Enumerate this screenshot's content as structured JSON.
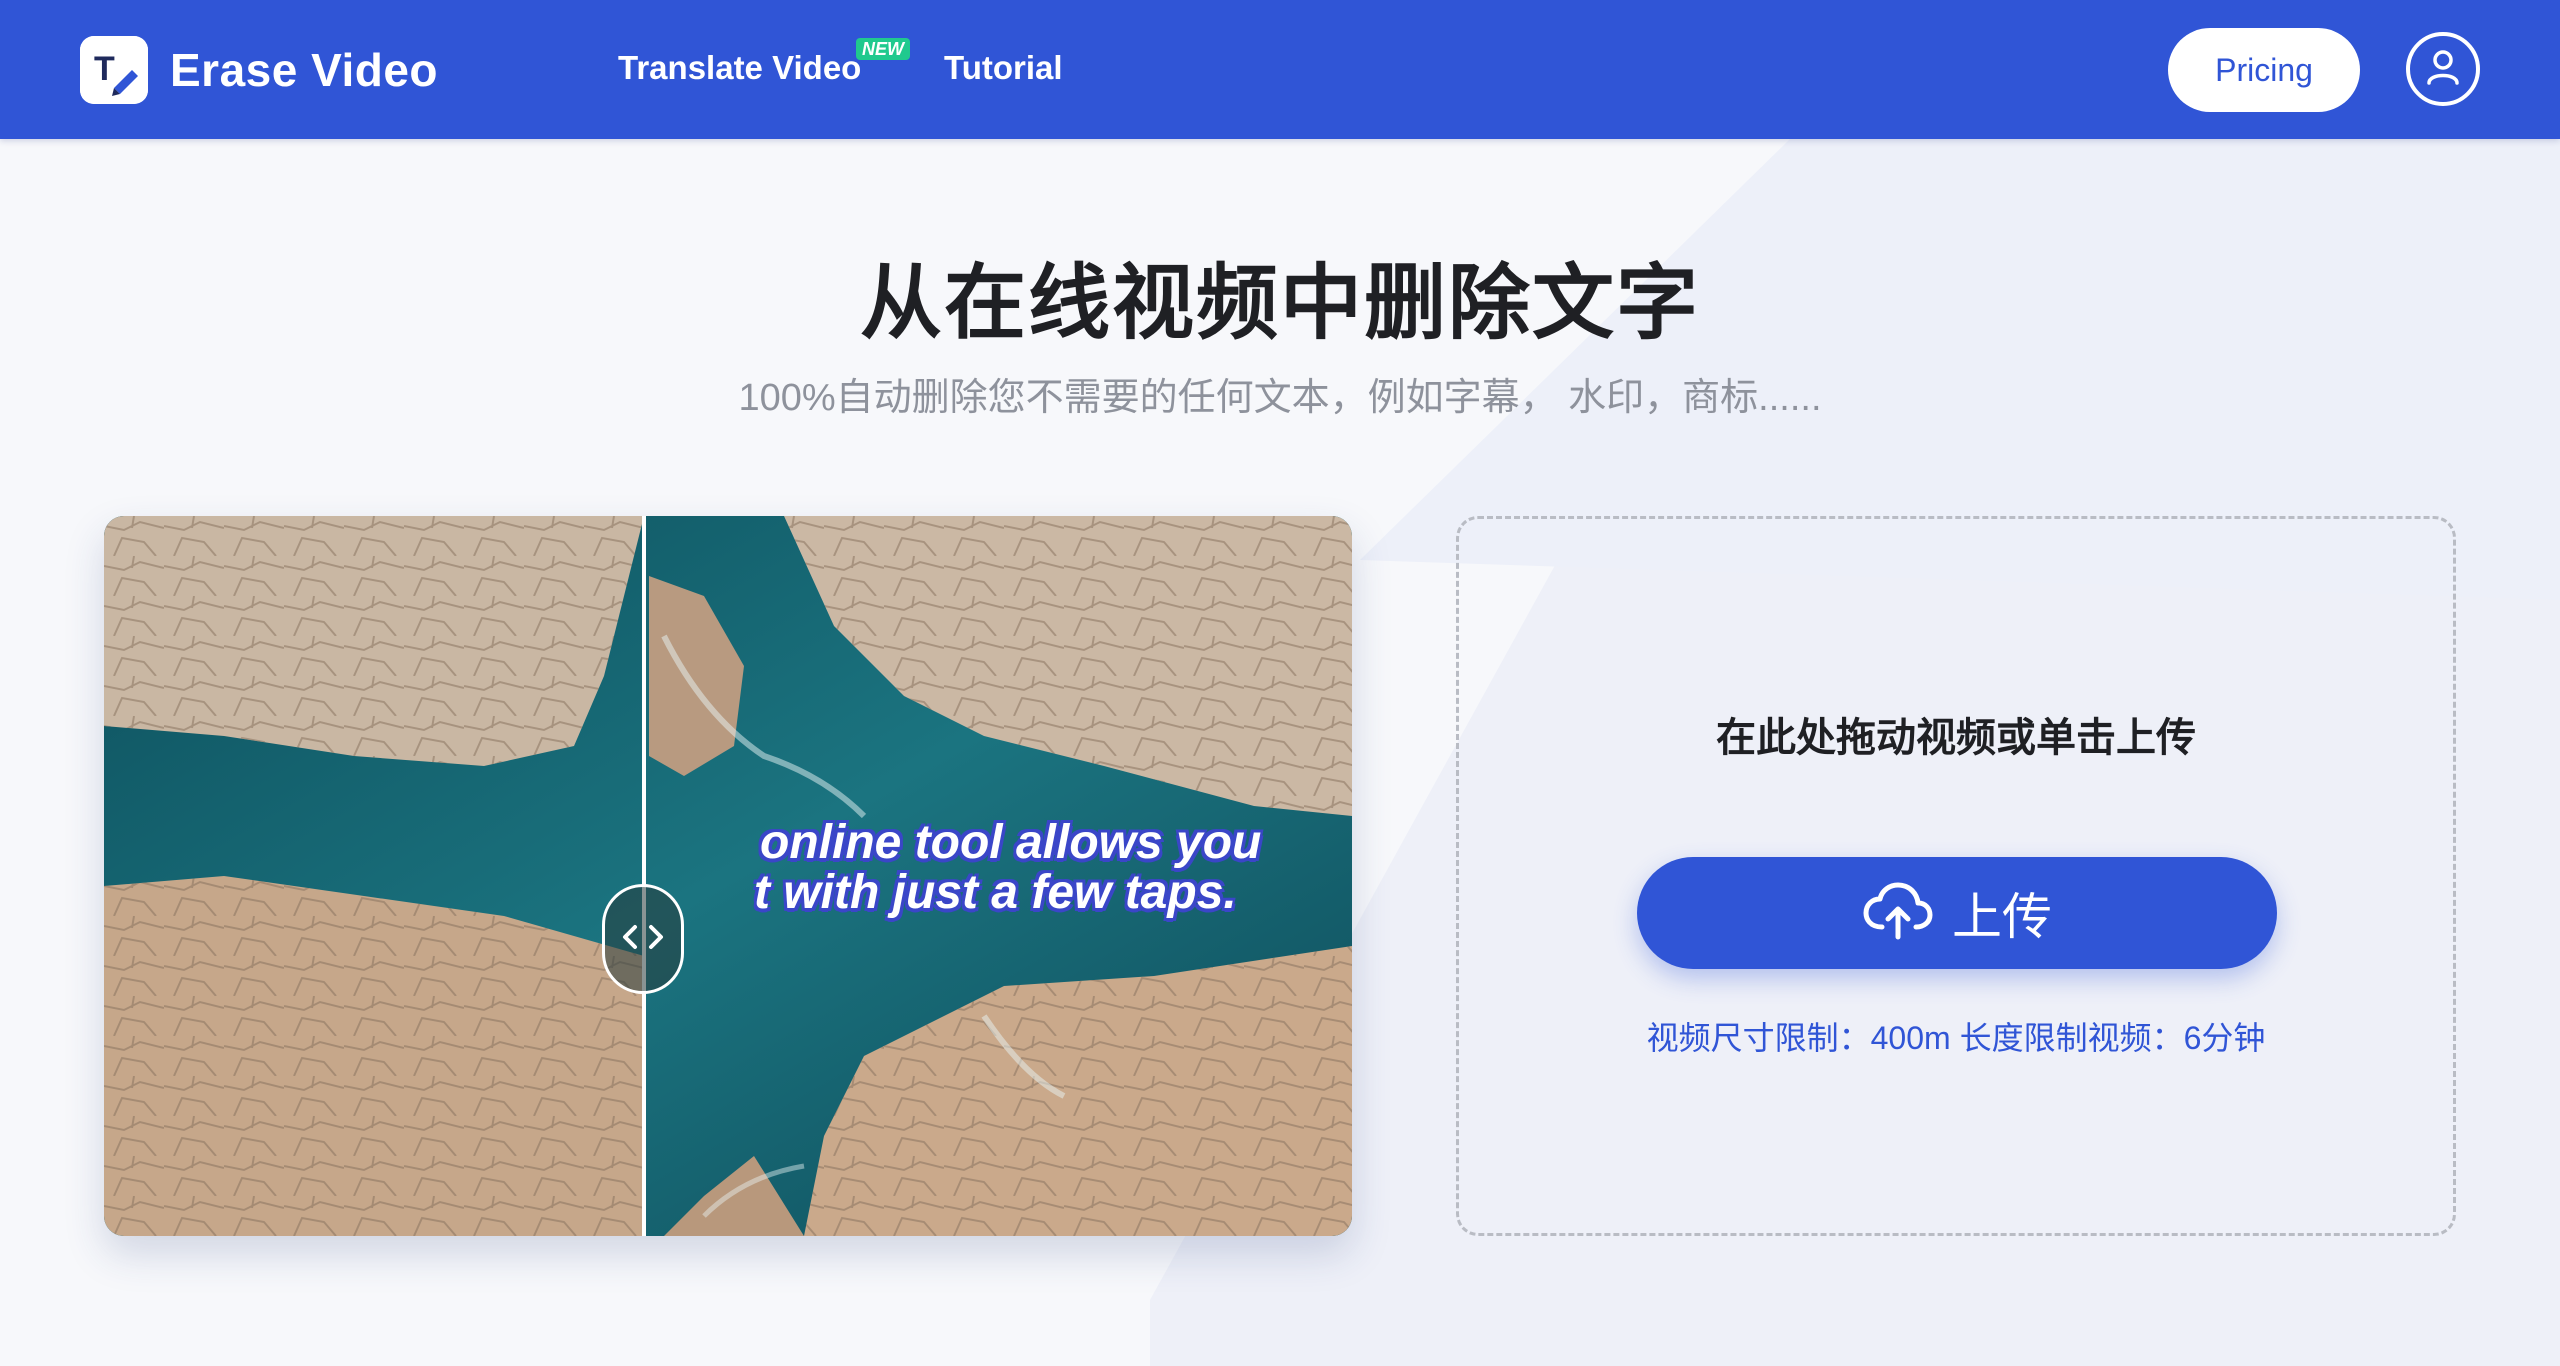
{
  "header": {
    "brand": "Erase Video",
    "nav": {
      "translate_video": "Translate Video",
      "new_badge": "NEW",
      "tutorial": "Tutorial"
    },
    "pricing_label": "Pricing",
    "account_icon": "user-circle-icon"
  },
  "hero": {
    "title": "从在线视频中删除文字",
    "subtitle": "100%自动删除您不需要的任何文本，例如字幕， 水印，商标......"
  },
  "preview": {
    "caption_line1": "online tool allows you",
    "caption_line2": "t with just a few taps.",
    "handle_icon": "chevron-left-right-icon"
  },
  "upload": {
    "drop_text": "在此处拖动视频或单击上传",
    "button_label": "上传",
    "button_icon": "cloud-upload-icon",
    "limits": "视频尺寸限制：400m  长度限制视频：6分钟"
  },
  "colors": {
    "brand_blue": "#3055d6",
    "new_badge": "#20c98e",
    "caption_outline": "#3a46c8"
  }
}
